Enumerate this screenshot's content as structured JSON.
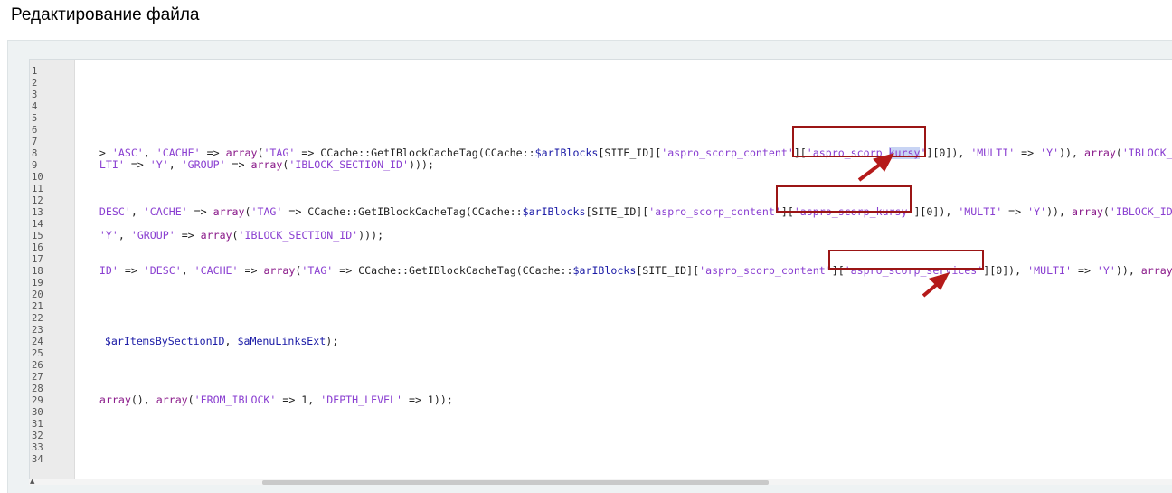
{
  "page": {
    "title": "Редактирование файла"
  },
  "editor": {
    "line_numbers": [
      "1",
      "2",
      "3",
      "4",
      "5",
      "6",
      "7",
      "8",
      "9",
      "10",
      "11",
      "12",
      "13",
      "14",
      "15",
      "16",
      "17",
      "18",
      "19",
      "20",
      "21",
      "22",
      "23",
      "24",
      "25",
      "26",
      "27",
      "28",
      "29",
      "30",
      "31",
      "32",
      "33",
      "34"
    ],
    "lines": {
      "l7": [
        "> ",
        "'ASC'",
        ", ",
        "'CACHE'",
        " => ",
        "array",
        "(",
        "'TAG'",
        " => CCache::GetIBlockCacheTag(CCache::",
        "$arIBlocks",
        "[SITE_ID][",
        "'aspro_scorp_content'",
        "][",
        "'aspro_scorp_",
        "kursy",
        "'",
        "][0]), ",
        "'MULTI'",
        " => ",
        "'Y'",
        ")), ",
        "array",
        "(",
        "'IBLOCK_I"
      ],
      "l8": [
        "LTI'",
        " => ",
        "'Y'",
        ", ",
        "'GROUP'",
        " => ",
        "array",
        "(",
        "'IBLOCK_SECTION_ID'",
        ")));"
      ],
      "l12": [
        "DESC'",
        ", ",
        "'CACHE'",
        " => ",
        "array",
        "(",
        "'TAG'",
        " => CCache::GetIBlockCacheTag(CCache::",
        "$arIBlocks",
        "[SITE_ID][",
        "'aspro_scorp_content'",
        "][",
        "'aspro_scorp_kursy'",
        "][0]), ",
        "'MULTI'",
        " => ",
        "'Y'",
        ")), ",
        "array",
        "(",
        "'IBLOCK_ID"
      ],
      "l14": [
        "'Y'",
        ", ",
        "'GROUP'",
        " => ",
        "array",
        "(",
        "'IBLOCK_SECTION_ID'",
        ")));"
      ],
      "l17": [
        "ID'",
        " => ",
        "'DESC'",
        ", ",
        "'CACHE'",
        " => ",
        "array",
        "(",
        "'TAG'",
        " => CCache::GetIBlockCacheTag(CCache::",
        "$arIBlocks",
        "[SITE_ID][",
        "'aspro_scorp_content'",
        "][",
        "'aspro_scorp_services'",
        "][0]), ",
        "'MULTI'",
        " => ",
        "'Y'",
        ")), ",
        "array"
      ],
      "l23": [
        "$arItemsBySectionID",
        ", ",
        "$aMenuLinksExt",
        ");"
      ],
      "l28": [
        "array",
        "(), ",
        "array",
        "(",
        "'FROM_IBLOCK'",
        " => 1, ",
        "'DEPTH_LEVEL'",
        " => 1));"
      ]
    }
  },
  "annotations": {
    "box_color": "#9b1515"
  },
  "colors": {
    "string": "#8a3fd1",
    "keyword": "#8a1a8a",
    "variable": "#1a1aa6",
    "text": "#222222"
  }
}
